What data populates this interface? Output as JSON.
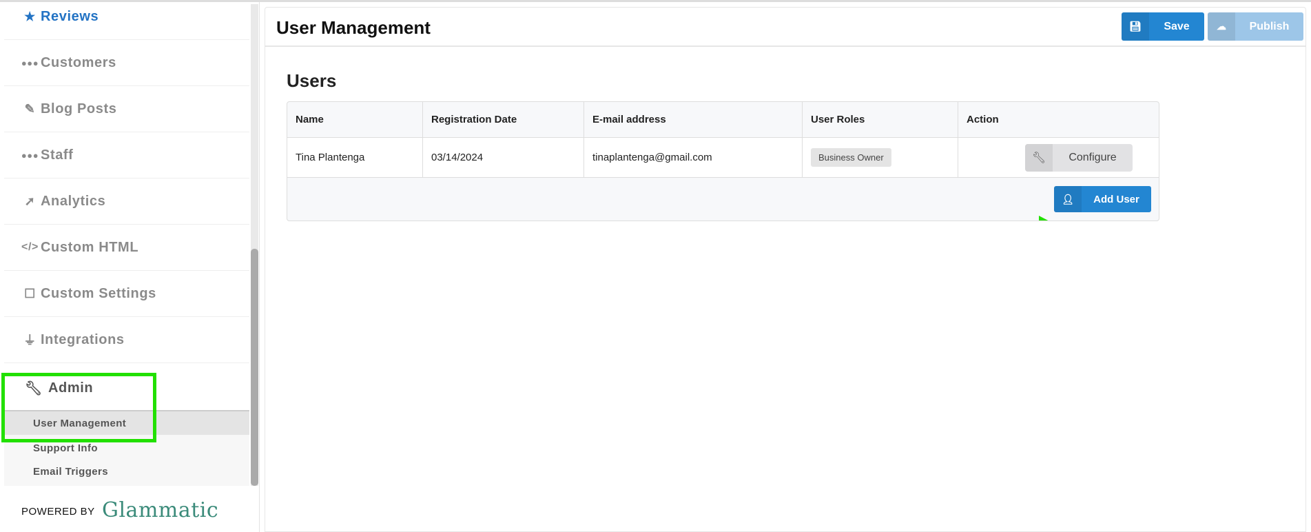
{
  "sidebar": {
    "items": [
      {
        "label": "Reviews",
        "icon": "star-icon"
      },
      {
        "label": "Customers",
        "icon": "users-icon"
      },
      {
        "label": "Blog Posts",
        "icon": "pencil-icon"
      },
      {
        "label": "Staff",
        "icon": "users-icon"
      },
      {
        "label": "Analytics",
        "icon": "rocket-icon"
      },
      {
        "label": "Custom HTML",
        "icon": "code-icon"
      },
      {
        "label": "Custom Settings",
        "icon": "sticky-note-icon"
      },
      {
        "label": "Integrations",
        "icon": "plug-icon"
      }
    ],
    "admin": {
      "label": "Admin",
      "icon": "wrench-icon",
      "subitems": [
        "User Management",
        "Support Info",
        "Email Triggers"
      ]
    },
    "powered_by": "POWERED BY",
    "brand": "Glammatic"
  },
  "header": {
    "title": "User Management",
    "save_label": "Save",
    "publish_label": "Publish"
  },
  "users": {
    "heading": "Users",
    "columns": [
      "Name",
      "Registration Date",
      "E-mail address",
      "User Roles",
      "Action"
    ],
    "rows": [
      {
        "name": "Tina Plantenga",
        "date": "03/14/2024",
        "email": "tinaplantenga@gmail.com",
        "role": "Business Owner",
        "action": "Configure"
      }
    ],
    "add_user_label": "Add User"
  },
  "colors": {
    "accent": "#2386d2",
    "highlight": "#22e000",
    "active_nav": "#2373c4"
  }
}
